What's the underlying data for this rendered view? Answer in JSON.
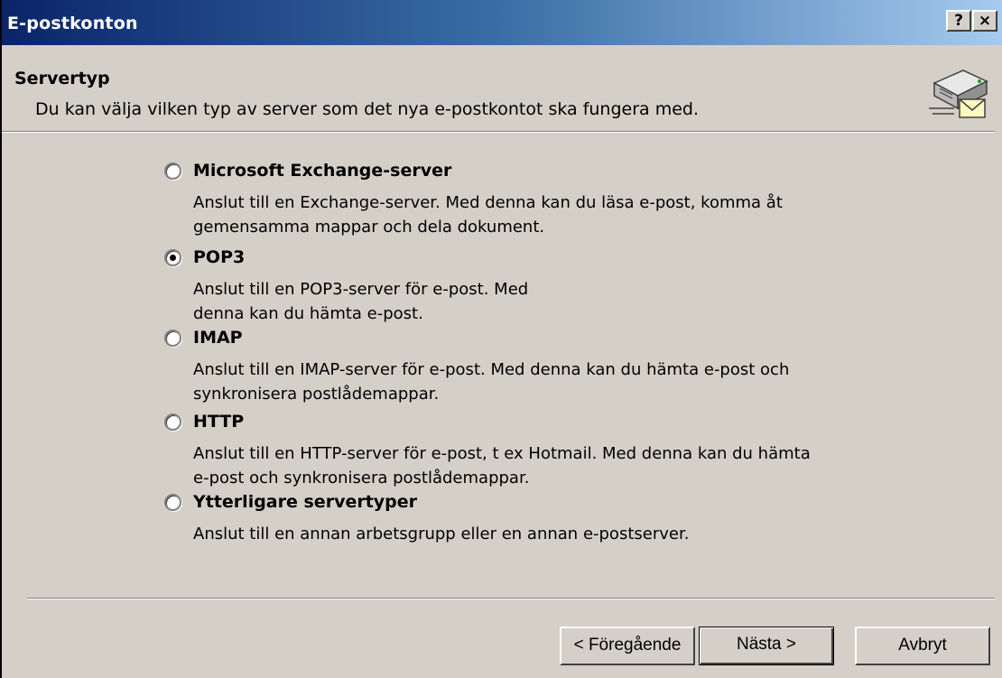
{
  "window": {
    "title": "E-postkonton",
    "help_button": "?",
    "close_button": "×"
  },
  "header": {
    "title": "Servertyp",
    "description": "Du kan välja vilken typ av server som det nya e-postkontot ska fungera med.",
    "icon": "mail-server-icon"
  },
  "options": [
    {
      "label": "Microsoft Exchange-server",
      "selected": false,
      "description_lines": [
        "Anslut till en Exchange-server. Med denna kan du läsa e-post, komma åt",
        "gemensamma mappar och dela dokument."
      ]
    },
    {
      "label": "POP3",
      "selected": true,
      "description_lines": [
        "Anslut till en POP3-server för e-post. Med",
        "denna kan du hämta e-post."
      ]
    },
    {
      "label": "IMAP",
      "selected": false,
      "description_lines": [
        "Anslut till en IMAP-server för e-post. Med denna kan du hämta e-post och",
        "synkronisera postlådemappar."
      ]
    },
    {
      "label": "HTTP",
      "selected": false,
      "description_lines": [
        "Anslut till en HTTP-server för e-post, t ex Hotmail. Med denna kan du hämta",
        "e-post och synkronisera postlådemappar."
      ]
    },
    {
      "label": "Ytterligare servertyper",
      "selected": false,
      "description_lines": [
        "Anslut till en annan arbetsgrupp eller en annan e-postserver."
      ]
    }
  ],
  "buttons": {
    "back": "< Föregående",
    "next": "Nästa >",
    "cancel": "Avbryt"
  }
}
